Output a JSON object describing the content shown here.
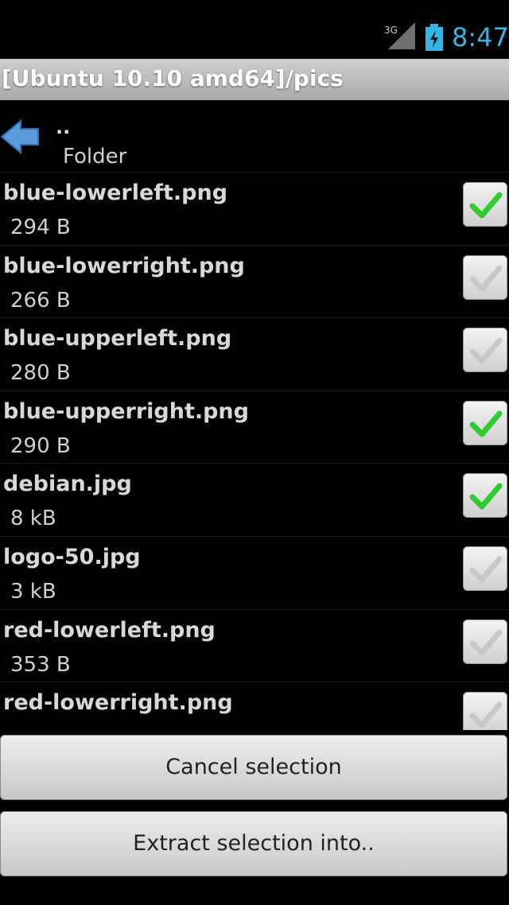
{
  "status_bar": {
    "network": "3G",
    "time": "8:47",
    "accent": "#33b5e5"
  },
  "title_bar": {
    "title": "[Ubuntu 10.10 amd64]/pics"
  },
  "parent": {
    "dots": "..",
    "label": "Folder",
    "icon": "back-arrow-icon"
  },
  "files": [
    {
      "name": "blue-lowerleft.png",
      "size": "294 B",
      "checked": true
    },
    {
      "name": "blue-lowerright.png",
      "size": "266 B",
      "checked": false
    },
    {
      "name": "blue-upperleft.png",
      "size": "280 B",
      "checked": false
    },
    {
      "name": "blue-upperright.png",
      "size": "290 B",
      "checked": true
    },
    {
      "name": "debian.jpg",
      "size": "8 kB",
      "checked": true
    },
    {
      "name": "logo-50.jpg",
      "size": "3 kB",
      "checked": false
    },
    {
      "name": "red-lowerleft.png",
      "size": "353 B",
      "checked": false
    },
    {
      "name": "red-lowerright.png",
      "size": "",
      "checked": false
    }
  ],
  "buttons": {
    "cancel": "Cancel selection",
    "extract": "Extract selection into.."
  },
  "colors": {
    "check_on": "#2ecc2e",
    "check_off": "#c8c8c8"
  }
}
